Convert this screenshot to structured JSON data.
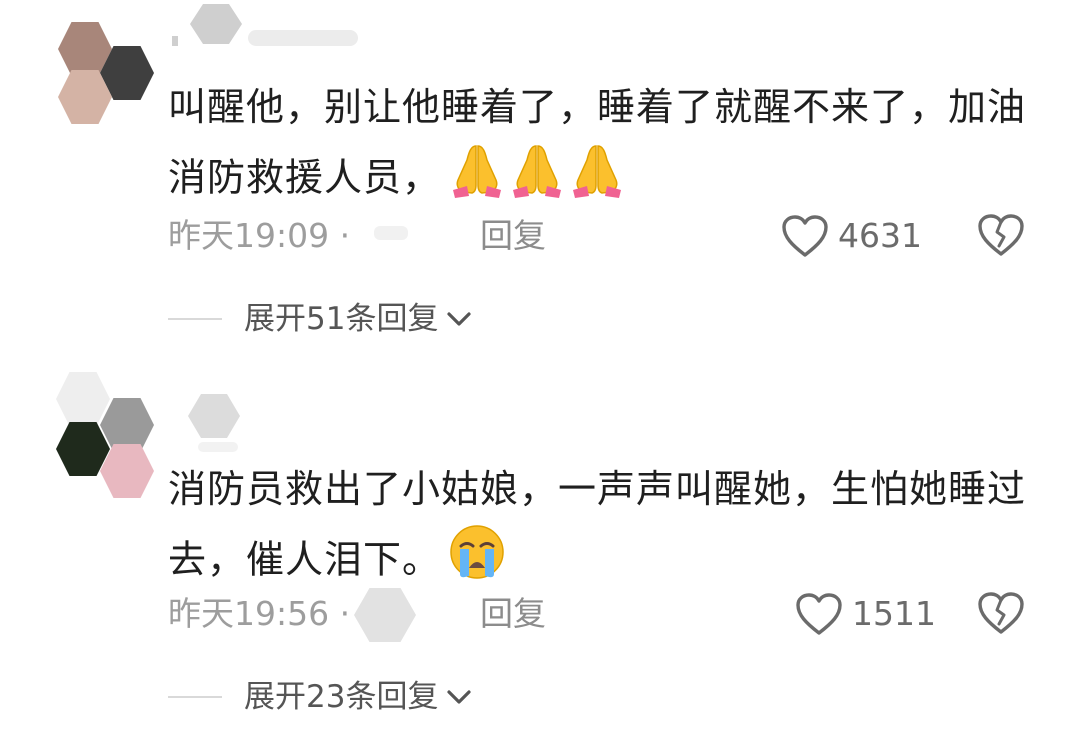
{
  "comments": [
    {
      "text": "叫醒他，别让他睡着了，睡着了就醒不来了，加油消防救援人员，",
      "emoji": [
        "folded-hands",
        "folded-hands",
        "folded-hands"
      ],
      "time": "昨天19:09",
      "separator": "·",
      "reply_label": "回复",
      "like_count": "4631",
      "expand_label": "展开51条回复"
    },
    {
      "text": "消防员救出了小姑娘，一声声叫醒她，生怕她睡过去，催人泪下。",
      "emoji": [
        "loudly-crying-face"
      ],
      "time": "昨天19:56",
      "separator": "·",
      "reply_label": "回复",
      "like_count": "1511",
      "expand_label": "展开23条回复"
    }
  ],
  "colors": {
    "text": "#1f1f1f",
    "meta": "#9d9d9d",
    "reply": "#8c8c8c",
    "icon": "#6b6b6b",
    "divider": "#d9d9d9",
    "emoji_yellow": "#fbc02d"
  }
}
